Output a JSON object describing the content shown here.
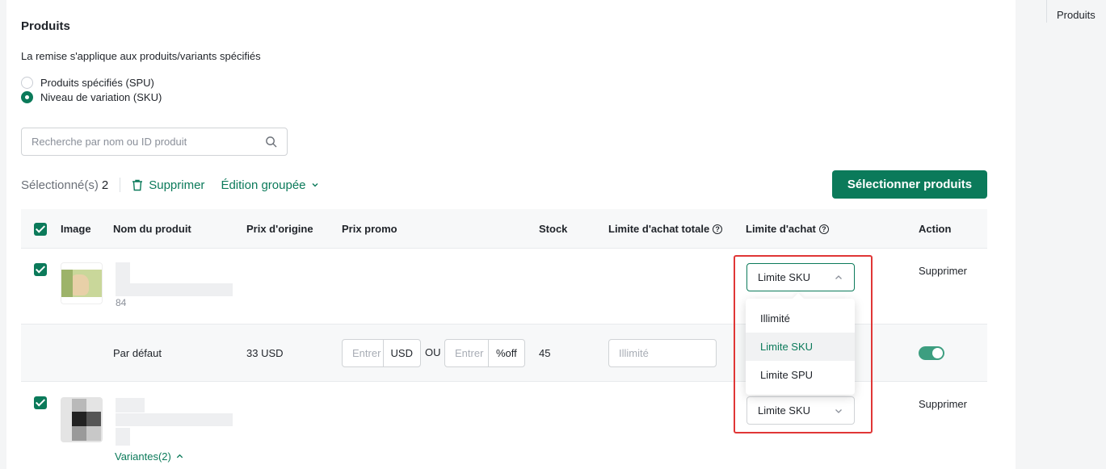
{
  "page": {
    "title": "Produits",
    "description": "La remise s'applique aux produits/variants spécifiés"
  },
  "scope_options": [
    {
      "label": "Produits spécifiés (SPU)",
      "selected": false
    },
    {
      "label": "Niveau de variation (SKU)",
      "selected": true
    }
  ],
  "search": {
    "placeholder": "Recherche par nom ou ID produit"
  },
  "toolbar": {
    "selected_label": "Sélectionné(s)",
    "selected_count": "2",
    "delete_label": "Supprimer",
    "bulk_edit_label": "Édition groupée",
    "select_products_label": "Sélectionner produits"
  },
  "table": {
    "headers": {
      "image": "Image",
      "name": "Nom du produit",
      "original_price": "Prix d'origine",
      "promo_price": "Prix promo",
      "stock": "Stock",
      "total_limit": "Limite d'achat totale",
      "purchase_limit": "Limite d'achat",
      "action": "Action"
    },
    "rows": [
      {
        "name_suffix": "84",
        "limit_value": "Limite SKU",
        "action": "Supprimer"
      },
      {
        "limit_value": "Limite SKU",
        "action": "Supprimer",
        "variants_label": "Variantes(2)"
      }
    ],
    "variant_row": {
      "name": "Par défaut",
      "original_price": "33 USD",
      "promo_placeholder": "Entrer",
      "promo_currency": "USD",
      "or_label": "OU",
      "discount_placeholder": "Entrer",
      "discount_suffix": "%off",
      "stock": "45",
      "total_limit_placeholder": "Illimité",
      "enabled": true
    }
  },
  "limit_dropdown": {
    "options": [
      "Illimité",
      "Limite SKU",
      "Limite SPU"
    ],
    "selected": "Limite SKU"
  },
  "right_panel": {
    "label": "Produits"
  },
  "colors": {
    "accent": "#0b7a5a",
    "highlight_box": "#e03636"
  }
}
